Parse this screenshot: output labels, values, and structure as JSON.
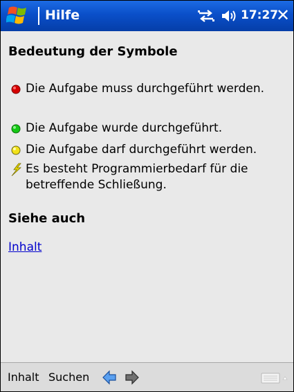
{
  "titlebar": {
    "app_title": "Hilfe",
    "clock": "17:27",
    "close_glyph": "✕",
    "icons": [
      "windows-start-icon",
      "connectivity-icon",
      "speaker-icon",
      "close-icon"
    ]
  },
  "content": {
    "heading": "Bedeutung der Symbole",
    "legend": [
      {
        "icon": "red-dot-icon",
        "color": "#d60000",
        "text": "Die Aufgabe muss durchgeführt werden."
      },
      {
        "icon": "green-dot-icon",
        "color": "#14c814",
        "text": "Die Aufgabe wurde durchgeführt."
      },
      {
        "icon": "yellow-dot-icon",
        "color": "#f2e21a",
        "text": "Die Aufgabe darf durchgeführt werden."
      },
      {
        "icon": "lightning-icon",
        "color": "#d8c800",
        "text": "Es besteht Programmierbedarf für die betreffende Schließung."
      }
    ],
    "see_also": "Siehe auch",
    "link": "Inhalt"
  },
  "bottombar": {
    "menu_inhalt": "Inhalt",
    "menu_suchen": "Suchen",
    "icons": [
      "back-arrow-icon",
      "forward-arrow-icon",
      "keyboard-icon"
    ]
  }
}
